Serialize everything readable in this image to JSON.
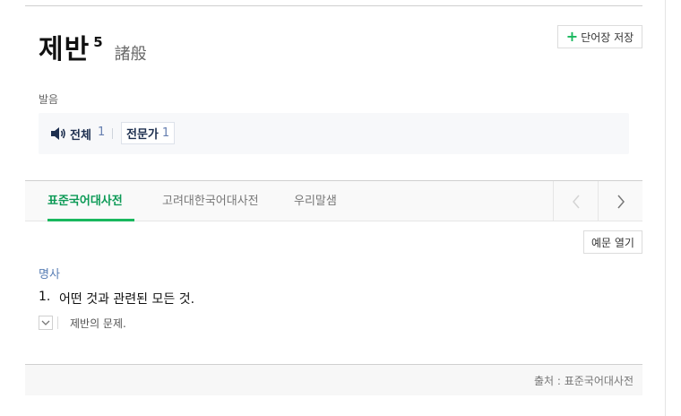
{
  "entry": {
    "headword": "제반",
    "homonym_number": "5",
    "hanja": "諸般"
  },
  "actions": {
    "save_label": "단어장 저장",
    "example_label": "예문 열기"
  },
  "pronunciation": {
    "label": "발음",
    "all_label": "전체",
    "all_count": "1",
    "expert_label": "전문가",
    "expert_count": "1"
  },
  "tabs": [
    {
      "label": "표준국어대사전",
      "active": true
    },
    {
      "label": "고려대한국어대사전",
      "active": false
    },
    {
      "label": "우리말샘",
      "active": false
    }
  ],
  "definition": {
    "part_of_speech": "명사",
    "senses": [
      {
        "number": "1.",
        "text": "어떤 것과 관련된 모든 것.",
        "example": "제반의 문제."
      }
    ]
  },
  "footer": {
    "source": "출처 : 표준국어대사전"
  },
  "colors": {
    "accent_green": "#19b85e",
    "pos_blue": "#5a7fb5",
    "pron_navy": "#1d2f4f"
  },
  "icons": [
    "plus-icon",
    "speaker-icon",
    "chevron-left-icon",
    "chevron-right-icon",
    "chevron-down-icon"
  ]
}
